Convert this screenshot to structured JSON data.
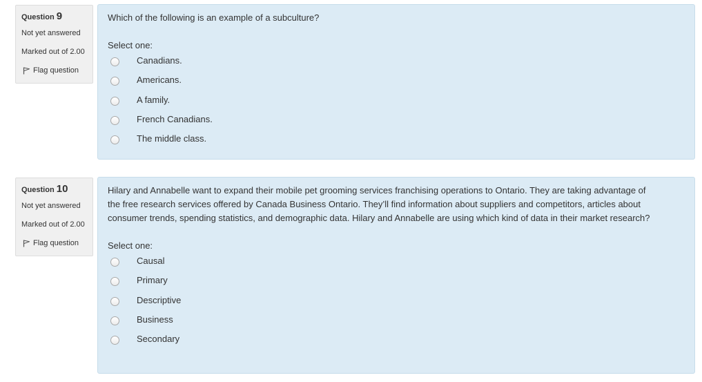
{
  "questions": [
    {
      "label": "Question",
      "number": "9",
      "state": "Not yet answered",
      "grade": "Marked out of 2.00",
      "flag_label": "Flag question",
      "text": "Which of the following is an example of a subculture?",
      "prompt": "Select one:",
      "answers": [
        "Canadians.",
        "Americans.",
        "A family.",
        "French Canadians.",
        "The middle class."
      ]
    },
    {
      "label": "Question",
      "number": "10",
      "state": "Not yet answered",
      "grade": "Marked out of 2.00",
      "flag_label": "Flag question",
      "text": "Hilary and Annabelle want to expand their mobile pet grooming services franchising operations to Ontario. They are taking advantage of the free research services offered by Canada Business Ontario. They’ll find information about suppliers and competitors, articles about consumer trends, spending statistics, and demographic data. Hilary and Annabelle are using which kind of data in their market research?",
      "prompt": "Select one:",
      "answers": [
        "Causal",
        "Primary",
        "Descriptive",
        "Business",
        "Secondary"
      ]
    }
  ],
  "colors": {
    "content_bg": "#dcebf5",
    "info_bg": "#f0f0f0"
  }
}
